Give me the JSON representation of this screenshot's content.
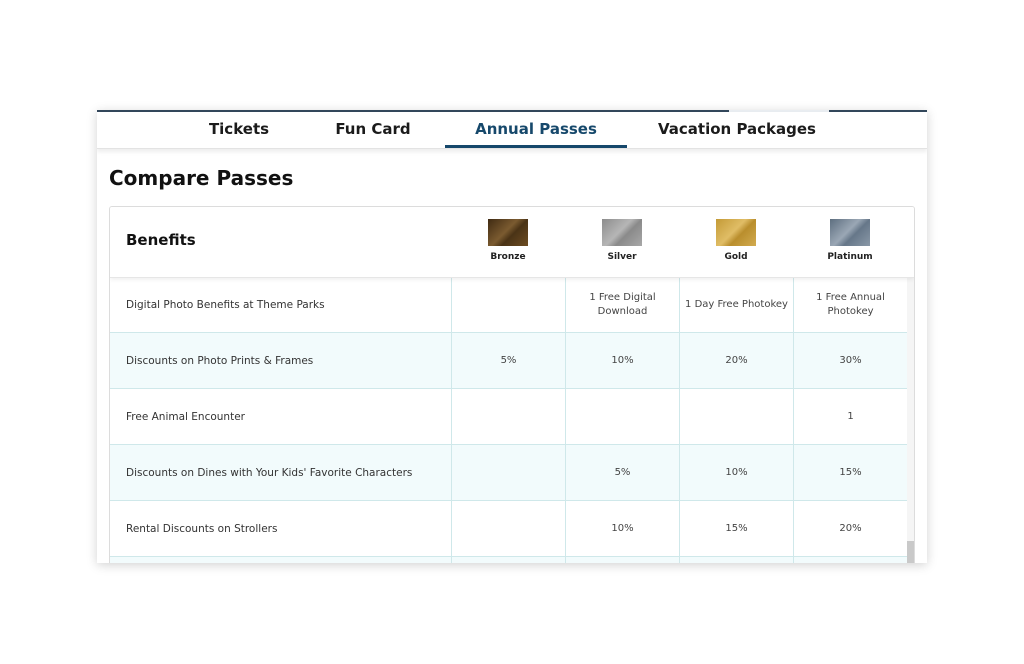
{
  "tabs": [
    {
      "label": "Tickets",
      "active": false
    },
    {
      "label": "Fun Card",
      "active": false
    },
    {
      "label": "Annual Passes",
      "active": true
    },
    {
      "label": "Vacation Packages",
      "active": false
    }
  ],
  "section_title": "Compare Passes",
  "table": {
    "header_label": "Benefits",
    "tiers": [
      "Bronze",
      "Silver",
      "Gold",
      "Platinum"
    ],
    "rows": [
      {
        "label": "Digital Photo Benefits at Theme Parks",
        "values": [
          "",
          "1 Free Digital Download",
          "1 Day Free Photokey",
          "1 Free Annual Photokey"
        ]
      },
      {
        "label": "Discounts on Photo Prints & Frames",
        "values": [
          "5%",
          "10%",
          "20%",
          "30%"
        ]
      },
      {
        "label": "Free Animal Encounter",
        "values": [
          "",
          "",
          "",
          "1"
        ]
      },
      {
        "label": "Discounts on Dines with Your Kids' Favorite Characters",
        "values": [
          "",
          "5%",
          "10%",
          "15%"
        ]
      },
      {
        "label": "Rental Discounts on Strollers",
        "values": [
          "",
          "10%",
          "15%",
          "20%"
        ]
      },
      {
        "label": "",
        "values": [
          "",
          "",
          "",
          ""
        ]
      }
    ]
  },
  "colors": {
    "accent": "#16486b",
    "row_alt_bg": "#f2fbfc",
    "cell_border": "#cfe8ea"
  }
}
